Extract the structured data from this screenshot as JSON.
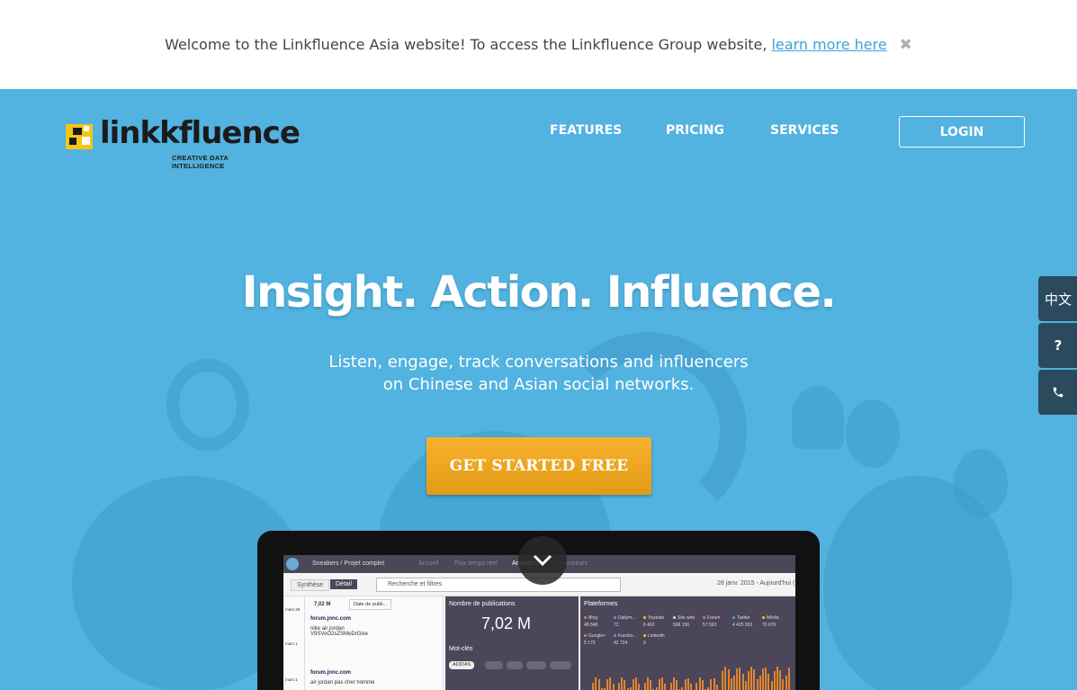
{
  "notice": {
    "text": "Welcome to the Linkfluence Asia website! To access the Linkfluence Group website,",
    "link": "learn more here",
    "close_icon": "close-icon"
  },
  "brand": {
    "name_pre": "link",
    "name_k": "k",
    "name_post": "fluence",
    "tagline": "CREATIVE DATA INTELLIGENCE",
    "accent": "#f5c518"
  },
  "nav": {
    "items": [
      "FEATURES",
      "PRICING",
      "SERVICES"
    ],
    "login": "LOGIN"
  },
  "hero": {
    "headline": "Insight. Action. Influence.",
    "subline1": "Listen, engage, track conversations and influencers",
    "subline2": "on Chinese and Asian social networks.",
    "cta": "GET STARTED FREE",
    "bg_color": "#52b2e0",
    "cta_color": "#f0a81f"
  },
  "side": {
    "lang": "中文",
    "help_icon": "question-icon",
    "phone_icon": "phone-icon"
  },
  "dashboard": {
    "project": "Sneakers / Projet complet",
    "tabs": [
      "Accueil",
      "Flux temps réel",
      "Analytics",
      "Influenceurs"
    ],
    "views": [
      "Synthèse",
      "Détail"
    ],
    "filter_placeholder": "Recherche et filtres",
    "date_range": "28 janv. 2015 - Aujourd'hui (",
    "count": "7,02 M",
    "sort": "Date de publi...",
    "pubs_title": "Nombre de publications",
    "pubs_value": "7,02 M",
    "keywords_title": "Mot-clés",
    "keyword_first": "ADIDAS",
    "platforms_title": "Plateformes",
    "platforms": [
      {
        "name": "Blog",
        "value": "48 848"
      },
      {
        "name": "Dailym...",
        "value": "72"
      },
      {
        "name": "Youtube",
        "value": "6 462"
      },
      {
        "name": "Site web",
        "value": "598 156"
      },
      {
        "name": "Forum",
        "value": "57 563"
      },
      {
        "name": "Twitter",
        "value": "4 425 993"
      },
      {
        "name": "Média",
        "value": "70 676"
      }
    ],
    "platforms2": [
      {
        "name": "Google+",
        "value": "5 173"
      },
      {
        "name": "Facebo...",
        "value": "42 724"
      },
      {
        "name": "Linkedin",
        "value": "9"
      }
    ],
    "posts": [
      {
        "source": "forum.jnnc.com",
        "time": "il y a quelq...",
        "text1": "nike air jordan",
        "text2": "V9SVoO2sZSMeDrGise",
        "tag": "nike"
      },
      {
        "source": "forum.jnnc.com",
        "time": "il y a quelq...",
        "text1": "air jordan pas cher homme",
        "text2": "",
        "tag": ""
      }
    ],
    "dates": [
      "mars 28",
      "mars 1",
      "mars 1",
      "mars 1"
    ]
  }
}
